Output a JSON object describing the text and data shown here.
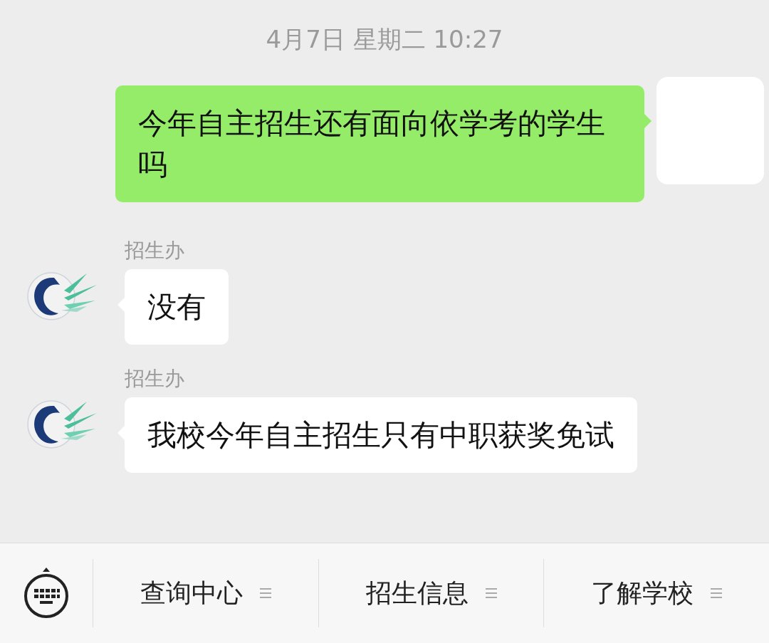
{
  "timestamp": "4月7日 星期二 10:27",
  "messages": [
    {
      "kind": "sent",
      "text": "今年自主招生还有面向依学考的学生吗"
    },
    {
      "kind": "received",
      "sender": "招生办",
      "text": "没有"
    },
    {
      "kind": "received",
      "sender": "招生办",
      "text": "我校今年自主招生只有中职获奖免试"
    }
  ],
  "menu": [
    {
      "label": "查询中心"
    },
    {
      "label": "招生信息"
    },
    {
      "label": "了解学校"
    }
  ]
}
